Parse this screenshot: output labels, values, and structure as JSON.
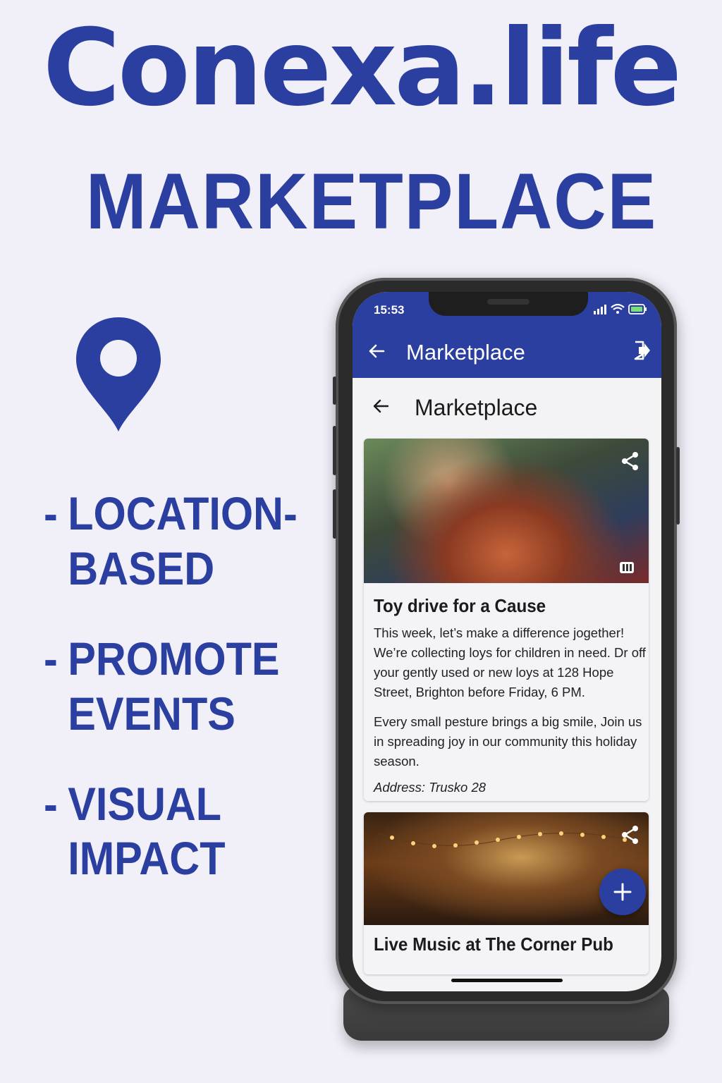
{
  "hero": {
    "brand": "Conexa.life",
    "subtitle": "MARKETPLACE",
    "pin_icon": "location-pin-icon"
  },
  "features": [
    {
      "dash": "-",
      "text": "LOCATION-\nBASED"
    },
    {
      "dash": "-",
      "text": "PROMOTE\nEVENTS"
    },
    {
      "dash": "-",
      "text": "VISUAL\nIMPACT"
    }
  ],
  "phone": {
    "status": {
      "time": "15:53"
    },
    "appbar": {
      "title": "Marketplace"
    },
    "page": {
      "title": "Marketplace"
    },
    "cards": [
      {
        "title": "Toy drive for a Cause",
        "body": [
          "This week, let’s make a difference jogether! We’re collecting loys for children in need. Dr off your gently used or new loys at 128 Hope Street, Brighton before Friday, 6 PM.",
          "Every small pesture brings a big smile, Join us in spreading joy in our community this holiday season."
        ],
        "address": "Address: Trusko 28"
      },
      {
        "title": "Live Music at The Corner Pub"
      }
    ]
  },
  "colors": {
    "brand": "#2a3f9f",
    "background": "#f1eff8"
  }
}
